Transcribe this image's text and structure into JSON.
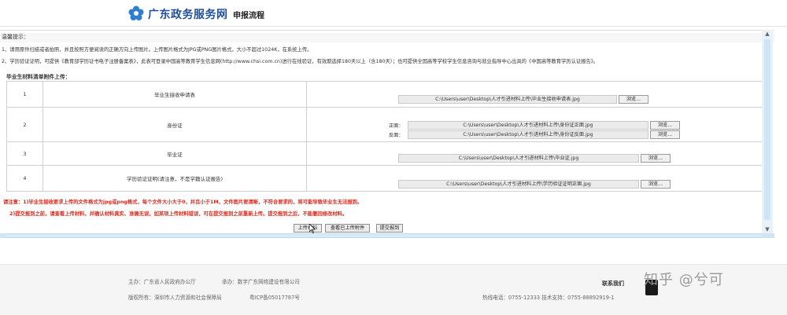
{
  "header": {
    "site_name": "广东政务服务网",
    "section": "申报流程"
  },
  "notice": {
    "heading": "温馨提示：",
    "lines": [
      "1、请用原件扫描或者拍照，并且按照方便阅读的正确方向上传图片。上传图片格式为JPG或PNG图片格式，大小不超过1024K，在系统上传。",
      "2、学历验证证明，可提供《教育部学历证书电子注册备案表》，此表可登录中国高等教育学生信息网(http://www.chsi.com.cn)进行在线验证，有效期选择180天以上（含180天）；也可提供全国高等学校学生信息咨询与就业指导中心出具的《中国高等教育学历认证报告》。"
    ]
  },
  "attachments": {
    "title": "毕业生材料清单附件上传：",
    "browse_label": "浏览...",
    "rows": [
      {
        "num": "1",
        "name": "毕业生接收申请表",
        "files": [
          {
            "side": "",
            "path": "C:\\Users\\user\\Desktop\\人才引进材料上传\\毕业生接收申请表.jpg"
          }
        ]
      },
      {
        "num": "2",
        "name": "身份证",
        "files": [
          {
            "side": "正面：",
            "path": "C:\\Users\\user\\Desktop\\人才引进材料上传\\身份证正面.jpg"
          },
          {
            "side": "反面：",
            "path": "C:\\Users\\user\\Desktop\\人才引进材料上传\\身份证反面.jpg"
          }
        ]
      },
      {
        "num": "3",
        "name": "毕业证",
        "files": [
          {
            "side": "",
            "path": "C:\\Users\\user\\Desktop\\人才引进材料上传\\毕业证.jpg"
          }
        ]
      },
      {
        "num": "4",
        "name": "学历验证证明(请注意，不是学籍认证报告)",
        "files": [
          {
            "side": "",
            "path": "C:\\Users\\user\\Desktop\\人才引进材料上传\\学历验证证明正面.jpg"
          }
        ]
      }
    ]
  },
  "warnings": [
    "请注意：1)毕业生接收要求上传的文件格式为jpg或png格式，每个文件大小大于0，并且小于1M，文件图片要清晰，不符合要求的，将可能导致毕业生无法报到。",
    "2)提交报到之前，请查看上传材料，并确认材料真实、准确无误，如某项上传材料错误，可在提交报到之前重新上传。提交报到之后，不能撤回修改材料。"
  ],
  "buttons": {
    "upload": "上传材料",
    "view": "查看已上传附件",
    "submit": "提交报到"
  },
  "footer": {
    "host": "主办：广东省人民政府办公厅",
    "undertaker": "承办：数字广东网络建设有限公司",
    "copyright": "版权所有：深圳市人力资源和社会保障局",
    "icp": "粤ICP备05017787号",
    "contact": "联系我们",
    "hotline": "热线电话：0755-12333 技术支持：0755-88892919-1",
    "watermark": "知乎 @兮可"
  },
  "colors": {
    "brand_blue": "#1f4e9c",
    "warning_red": "#d92a1e",
    "scroll_blue": "#cfe4f5"
  }
}
